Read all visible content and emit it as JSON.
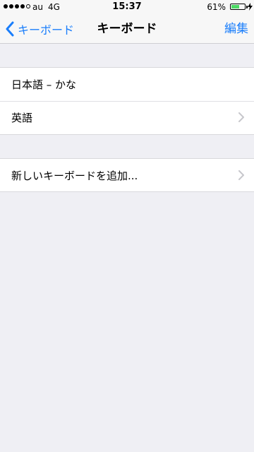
{
  "status_bar": {
    "carrier": "au",
    "network": "4G",
    "time": "15:37",
    "battery_percent": "61%",
    "battery_level": 0.61,
    "signal_bars_filled": 4,
    "signal_bars_total": 5,
    "battery_color": "#4cd964"
  },
  "nav": {
    "back_label": "キーボード",
    "title": "キーボード",
    "edit_label": "編集",
    "accent_color": "#1a7efb"
  },
  "keyboards": {
    "items": [
      {
        "label": "日本語 – かな",
        "has_chevron": false
      },
      {
        "label": "英語",
        "has_chevron": true
      }
    ]
  },
  "add_keyboard": {
    "label": "新しいキーボードを追加..."
  }
}
